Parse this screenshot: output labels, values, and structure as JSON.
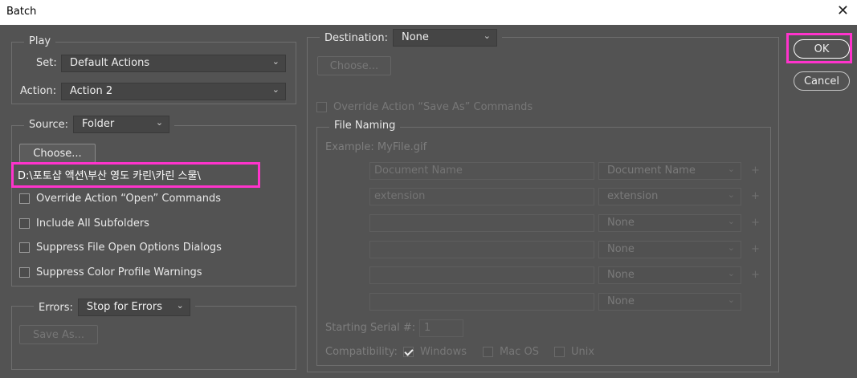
{
  "window": {
    "title": "Batch",
    "close_glyph": "✕"
  },
  "play": {
    "legend": "Play",
    "set_label": "Set:",
    "set_value": "Default Actions",
    "action_label": "Action:",
    "action_value": "Action 2"
  },
  "source": {
    "label": "Source:",
    "value": "Folder",
    "choose": "Choose...",
    "path": "D:\\포토샵 액션\\부산 영도 카린\\카린 스물\\",
    "override_open": "Override Action “Open” Commands",
    "include_subfolders": "Include All Subfolders",
    "suppress_file_open": "Suppress File Open Options Dialogs",
    "suppress_color": "Suppress Color Profile Warnings"
  },
  "errors": {
    "label": "Errors:",
    "value": "Stop for Errors",
    "save_as": "Save As..."
  },
  "destination": {
    "label": "Destination:",
    "value": "None",
    "choose": "Choose...",
    "override_save": "Override Action “Save As” Commands"
  },
  "file_naming": {
    "legend": "File Naming",
    "example": "Example: MyFile.gif",
    "rows": [
      {
        "field": "Document Name",
        "select": "Document Name",
        "plus": "+"
      },
      {
        "field": "extension",
        "select": "extension",
        "plus": "+"
      },
      {
        "field": "",
        "select": "None",
        "plus": "+"
      },
      {
        "field": "",
        "select": "None",
        "plus": "+"
      },
      {
        "field": "",
        "select": "None",
        "plus": "+"
      },
      {
        "field": "",
        "select": "None",
        "plus": ""
      }
    ],
    "serial_label": "Starting Serial #:",
    "serial_value": "1",
    "compat_label": "Compatibility:",
    "windows": "Windows",
    "macos": "Mac OS",
    "unix": "Unix"
  },
  "actions": {
    "ok": "OK",
    "cancel": "Cancel"
  },
  "colors": {
    "highlight": "#ff33cc",
    "panel": "#535353"
  }
}
